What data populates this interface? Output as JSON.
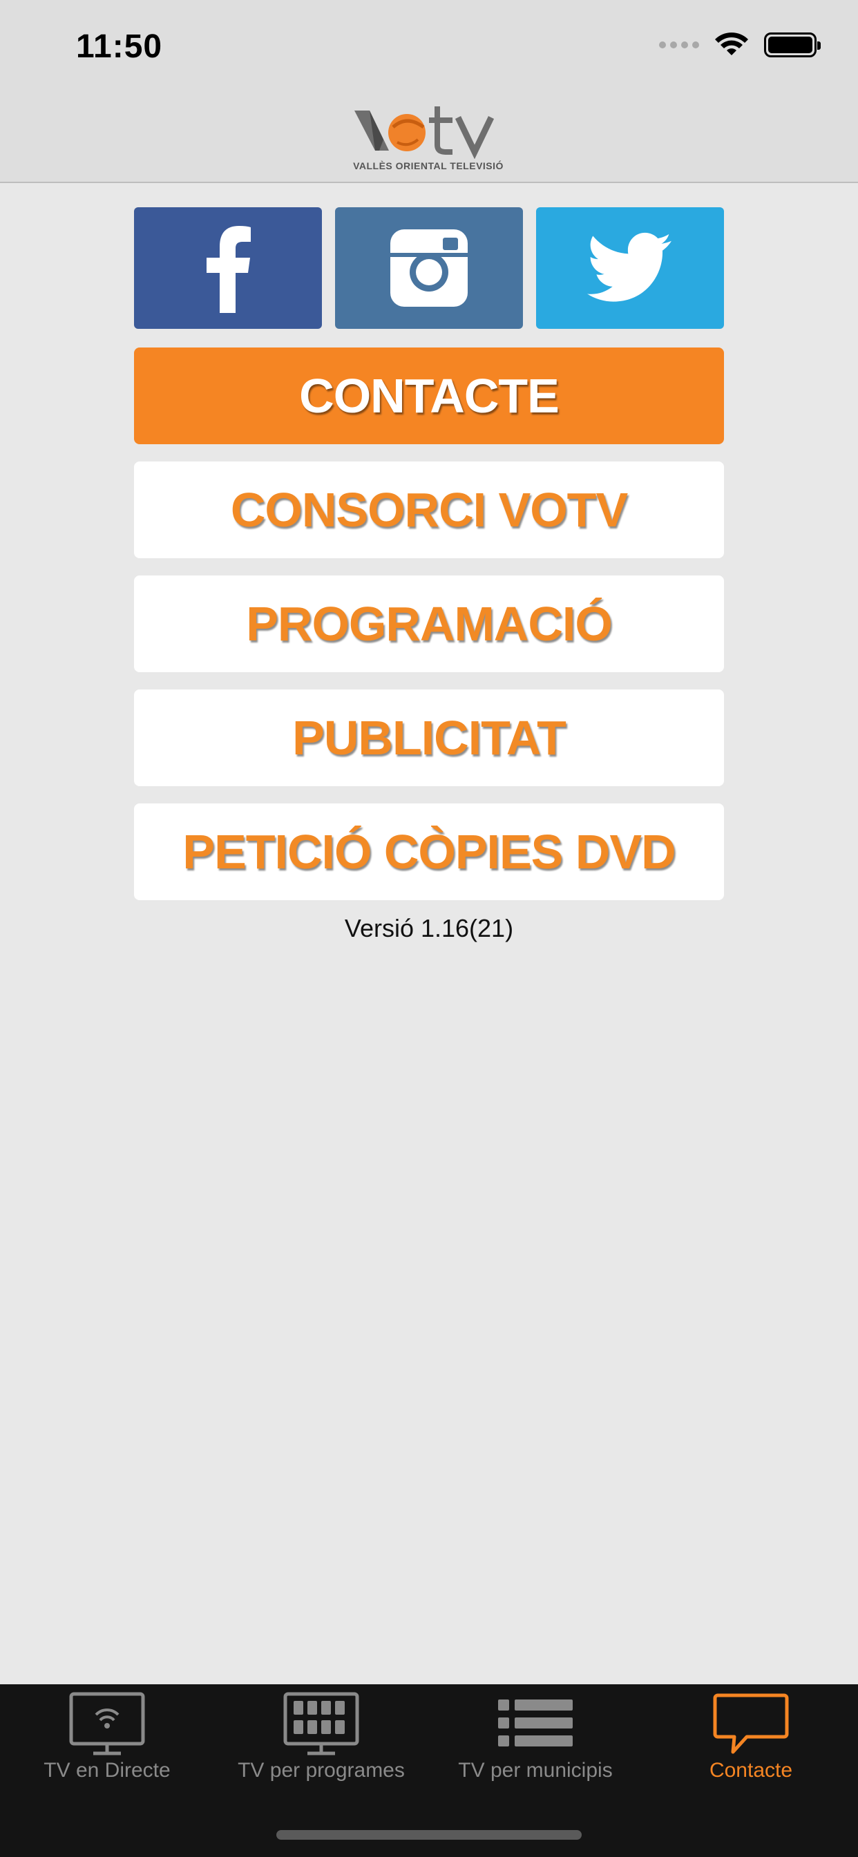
{
  "status_bar": {
    "time": "11:50"
  },
  "header": {
    "logo_text": "votv",
    "logo_subtitle": "VALLÈS ORIENTAL TELEVISIÓ"
  },
  "social": [
    {
      "name": "facebook",
      "icon": "facebook-icon",
      "color": "#3b5998"
    },
    {
      "name": "instagram",
      "icon": "instagram-icon",
      "color": "#48749f"
    },
    {
      "name": "twitter",
      "icon": "twitter-icon",
      "color": "#2aa9e0"
    }
  ],
  "menu": {
    "contacte": "CONTACTE",
    "consorci": "CONSORCI VOTV",
    "programacio": "PROGRAMACIÓ",
    "publicitat": "PUBLICITAT",
    "peticio": "PETICIÓ CÒPIES DVD"
  },
  "version": "Versió 1.16(21)",
  "tabbar": {
    "items": [
      {
        "label": "TV en Directe",
        "icon": "live-tv-icon",
        "active": false
      },
      {
        "label": "TV per programes",
        "icon": "programs-grid-icon",
        "active": false
      },
      {
        "label": "TV per municipis",
        "icon": "list-icon",
        "active": false
      },
      {
        "label": "Contacte",
        "icon": "chat-bubble-icon",
        "active": true
      }
    ]
  },
  "colors": {
    "accent": "#f58523",
    "background": "#e8e8e8",
    "tabbar": "#141414"
  }
}
